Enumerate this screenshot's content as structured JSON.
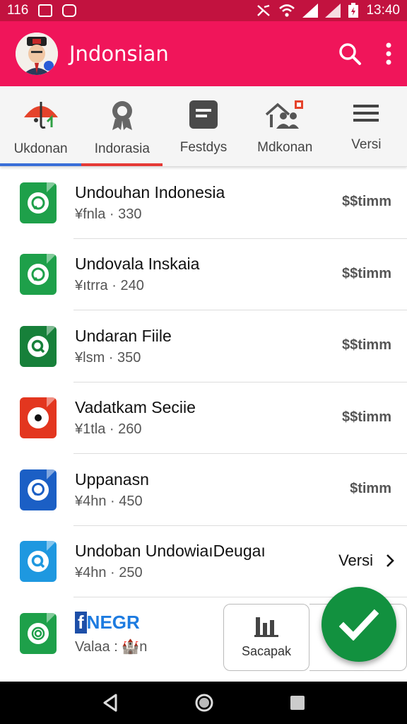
{
  "status_bar": {
    "time_left": "116",
    "time_right": "13:40"
  },
  "app_bar": {
    "title": "Jndonsian"
  },
  "tabs": [
    {
      "label": "Ukdonan",
      "icon": "umbrella-icon"
    },
    {
      "label": "Indorasia",
      "icon": "award-icon"
    },
    {
      "label": "Festdys",
      "icon": "document-icon"
    },
    {
      "label": "Mdkonan",
      "icon": "house-people-icon"
    },
    {
      "label": "Versi",
      "icon": "menu-icon"
    }
  ],
  "list": [
    {
      "title": "Undouhan Indonesia",
      "subtitle": "¥fnla · 330",
      "right": "$$timm",
      "color": "#1ea04a",
      "icon": "chat-icon"
    },
    {
      "title": "Undovala Inskaia",
      "subtitle": "¥ıtrra · 240",
      "right": "$$timm",
      "color": "#1ea04a",
      "icon": "chat-icon"
    },
    {
      "title": "Undaran Fiile",
      "subtitle": "¥lsm · 350",
      "right": "$$timm",
      "color": "#17803a",
      "icon": "search-icon"
    },
    {
      "title": "Vadatkam Seciie",
      "subtitle": "¥1tla · 260",
      "right": "$$timm",
      "color": "#e3361f",
      "icon": "record-icon"
    },
    {
      "title": "Uppanasn",
      "subtitle": "¥4hn · 450",
      "right": "$timm",
      "color": "#1b5fc5",
      "icon": "chat-bubble-icon"
    },
    {
      "title": "Undoban UndowiaıDeugaı",
      "subtitle": "¥4hn · 250",
      "right": "Versi",
      "color": "#1e98e0",
      "icon": "search-icon"
    },
    {
      "title": "NEGR",
      "subtitle": "Valaa : 🏰n",
      "right": "",
      "color": "#1ea04a",
      "icon": "fingerprint-icon"
    }
  ],
  "card_button": {
    "label": "Sacapak"
  },
  "colors": {
    "status_bar": "#c2123f",
    "app_bar": "#f0155a",
    "fab": "#12913f",
    "tab_active_1": "#3a6fd8",
    "tab_active_2": "#e53935"
  }
}
